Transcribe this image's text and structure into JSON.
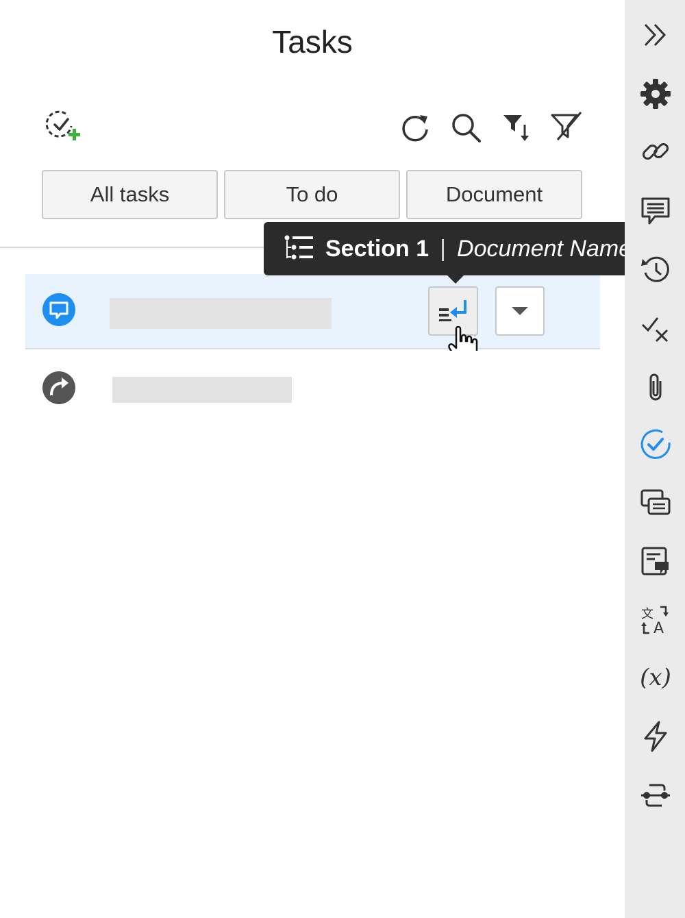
{
  "panel": {
    "title": "Tasks"
  },
  "toolbar": {
    "icons": [
      "add-task-icon",
      "refresh-icon",
      "search-icon",
      "sort-filter-icon",
      "clear-filter-icon"
    ]
  },
  "filter_tabs": [
    {
      "label": "All tasks"
    },
    {
      "label": "To do"
    },
    {
      "label": "Document"
    }
  ],
  "tooltip": {
    "icon": "outline-icon",
    "section": "Section 1",
    "separator": "|",
    "document": "Document Name"
  },
  "tasks": [
    {
      "type_icon": "comment-icon",
      "state": "selected",
      "icon_color": "#1e8ff0"
    },
    {
      "type_icon": "forward-icon",
      "state": "normal",
      "icon_color": "#555555"
    }
  ],
  "sidebar": {
    "icons": [
      "expand-icon",
      "gear-icon",
      "link-icon",
      "comment-icon",
      "history-icon",
      "check-x-icon",
      "paperclip-icon",
      "tasks-check-icon",
      "messages-icon",
      "document-comment-icon",
      "translate-icon",
      "variable-icon",
      "lightning-icon",
      "connector-icon"
    ],
    "active": "tasks-check-icon",
    "variable_label": "(x)"
  },
  "colors": {
    "accent": "#1e8ff0",
    "add_green": "#3fb13f",
    "tooltip_bg": "#2b2b2b",
    "selected_row": "#e8f3fd",
    "sidebar_bg": "#ebebeb"
  }
}
